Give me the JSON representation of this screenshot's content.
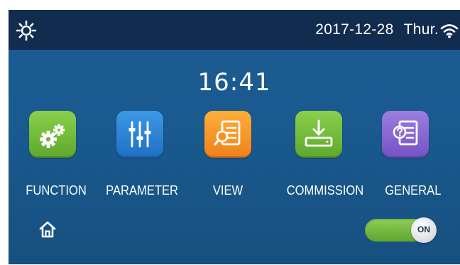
{
  "status_bar": {
    "date": "2017-12-28",
    "weekday": "Thur.",
    "icons": [
      "sun-icon",
      "wifi-icon"
    ]
  },
  "clock": {
    "time": "16:41"
  },
  "menu": {
    "items": [
      {
        "label": "FUNCTION",
        "icon": "gears-icon",
        "color": "#6dba3a"
      },
      {
        "label": "PARAMETER",
        "icon": "sliders-icon",
        "color": "#2a82d6"
      },
      {
        "label": "VIEW",
        "icon": "document-search-icon",
        "color": "#f7931f"
      },
      {
        "label": "COMMISSION",
        "icon": "download-icon",
        "color": "#6dba3a"
      },
      {
        "label": "GENERAL",
        "icon": "document-help-icon",
        "color": "#8766d4"
      }
    ]
  },
  "bottom_bar": {
    "home_icon": "home-icon",
    "power_toggle": {
      "label": "ON",
      "state": "on",
      "color": "#6dba3a"
    }
  }
}
